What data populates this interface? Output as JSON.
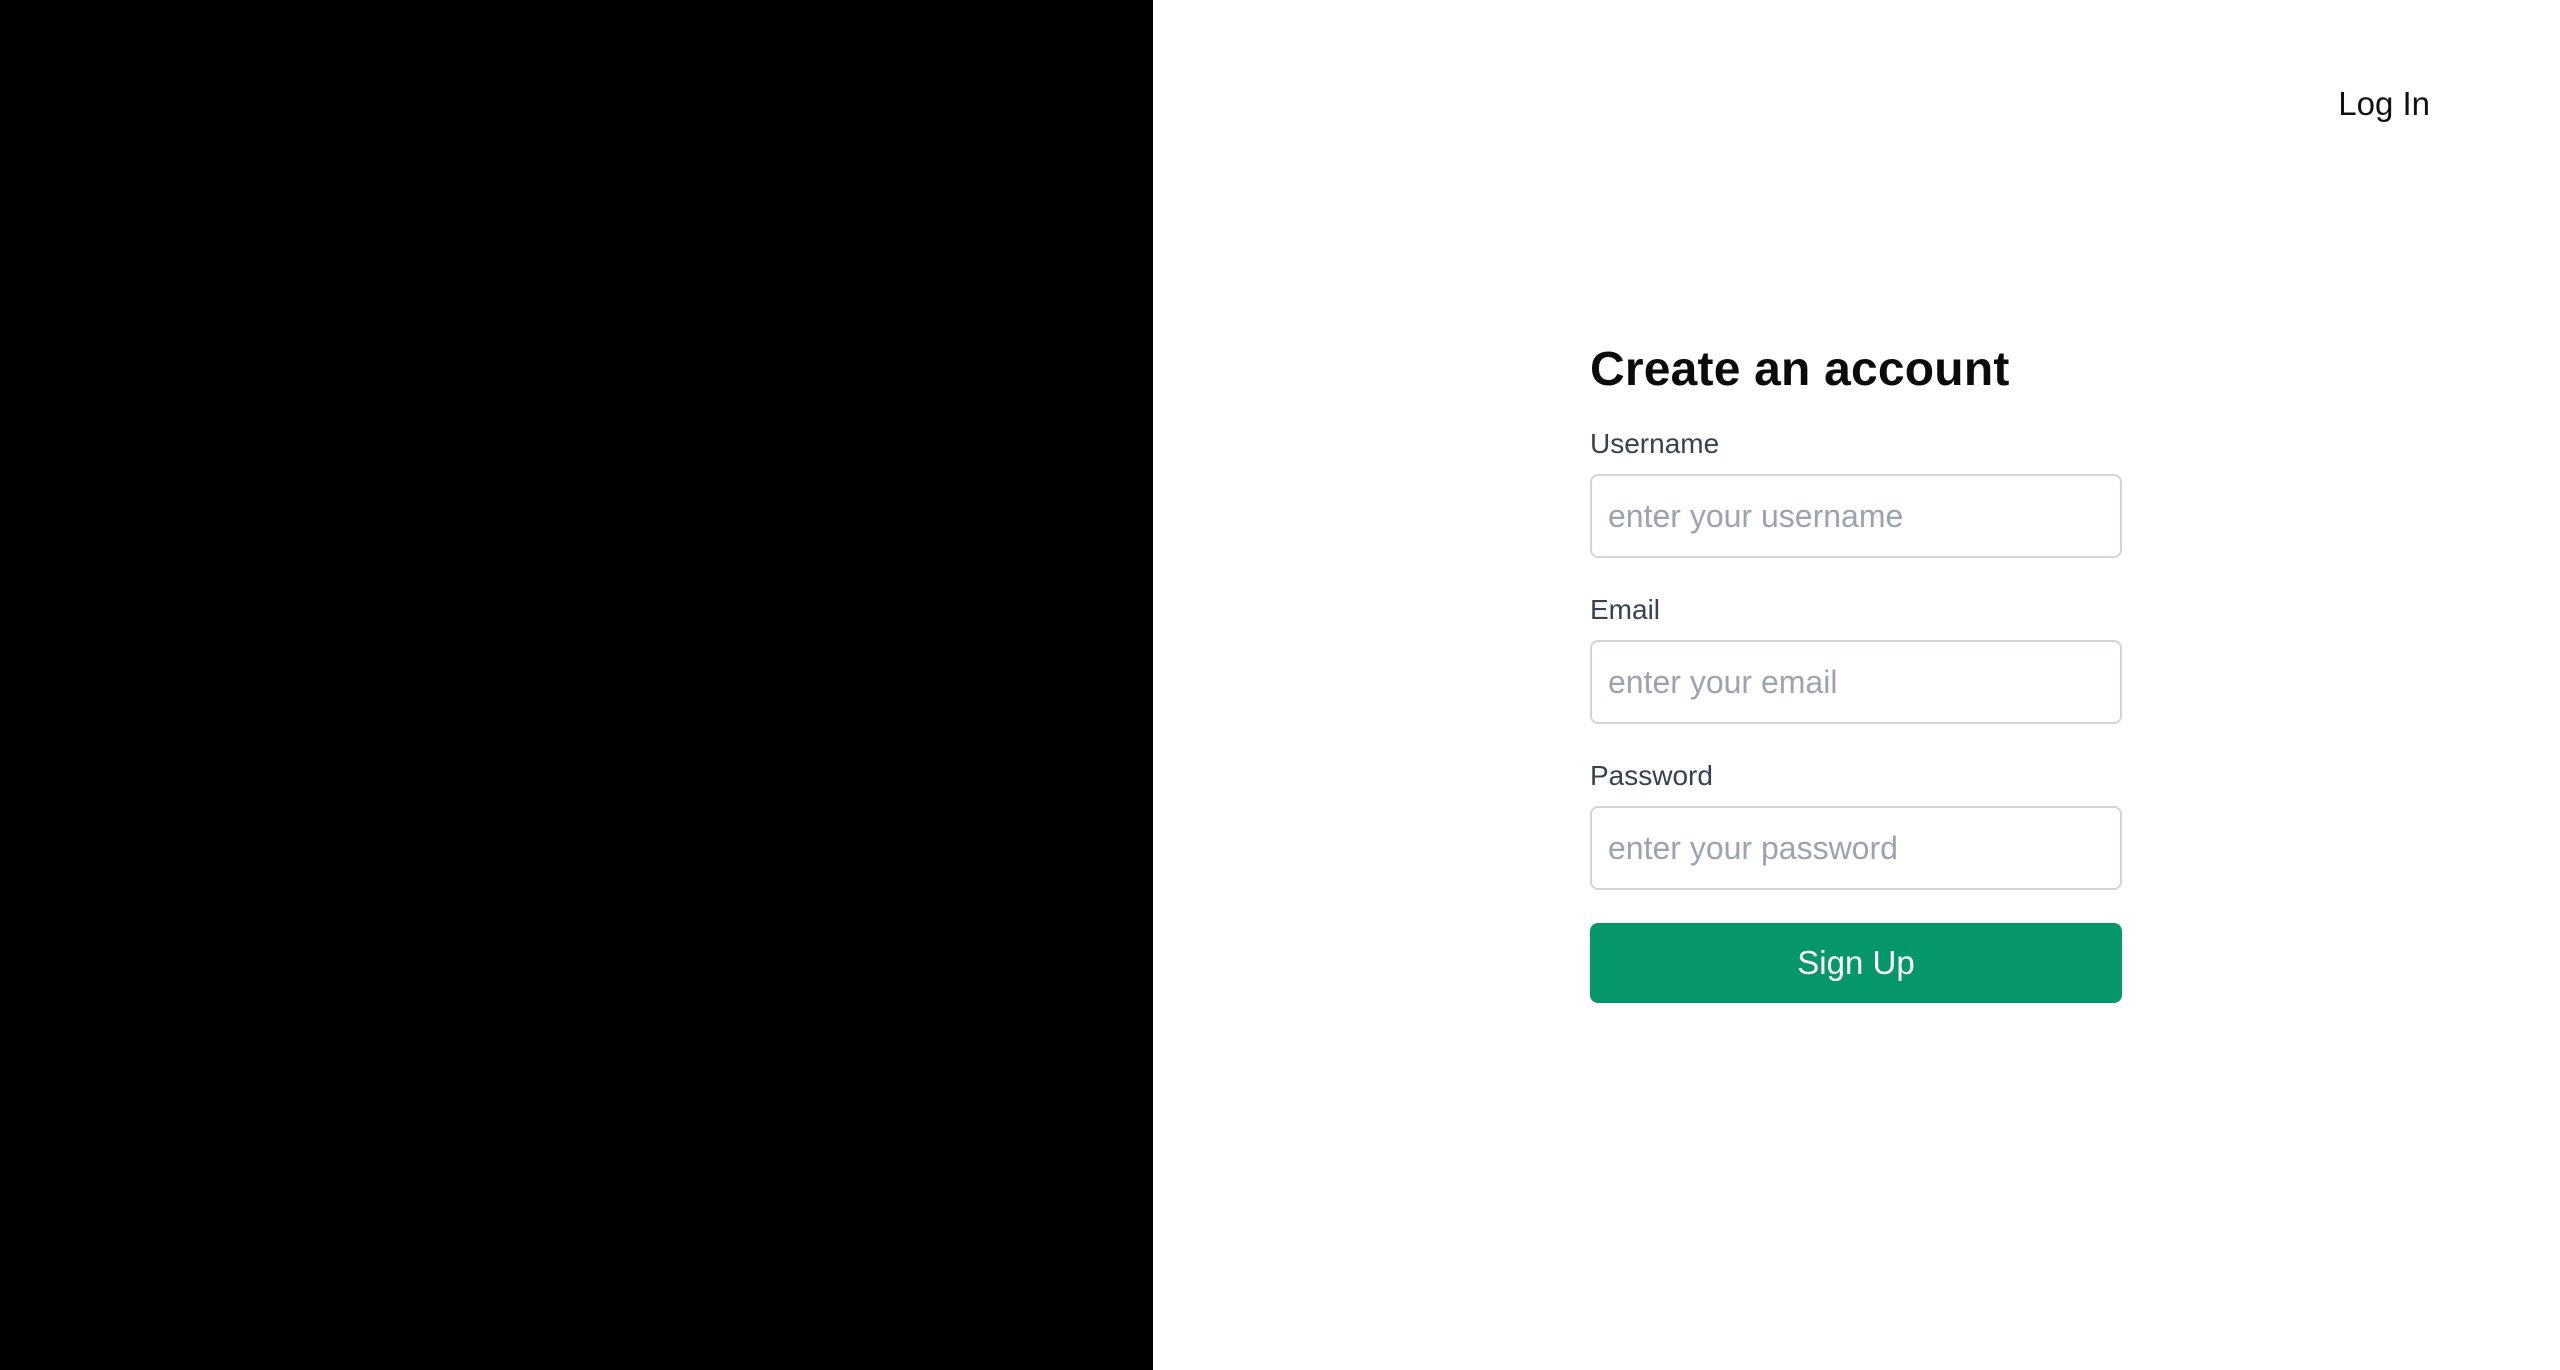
{
  "header": {
    "login_label": "Log In"
  },
  "form": {
    "title": "Create an account",
    "username": {
      "label": "Username",
      "value": "",
      "placeholder": "enter your username"
    },
    "email": {
      "label": "Email",
      "value": "",
      "placeholder": "enter your email"
    },
    "password": {
      "label": "Password",
      "value": "",
      "placeholder": "enter your password"
    },
    "submit_label": "Sign Up"
  },
  "colors": {
    "left_panel": "#000000",
    "background": "#ffffff",
    "accent": "#059669",
    "label": "#374151",
    "placeholder": "#9ca3af",
    "input_border": "#d1d5db"
  }
}
